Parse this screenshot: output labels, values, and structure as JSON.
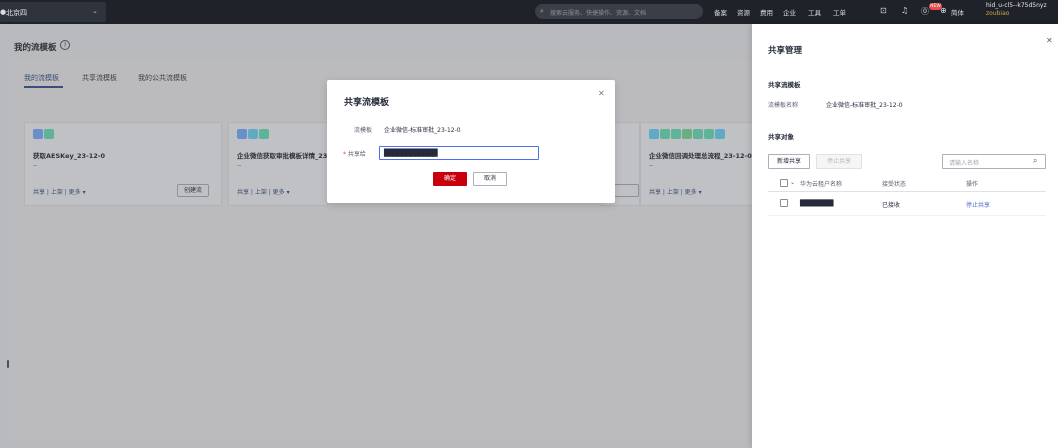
{
  "topbar": {
    "region": "北京四",
    "search_placeholder": "搜索云服务、快捷操作、资源、文档",
    "links": [
      "备案",
      "资源",
      "费用",
      "企业",
      "工具",
      "工单"
    ],
    "language": "简体",
    "badge": "NEW",
    "user_name": "hid_u-cl5--k75d5nyz",
    "user_sub": "zoubiao"
  },
  "page": {
    "title": "我的流模板",
    "tabs": [
      "我的流模板",
      "共享流模板",
      "我的公共流模板"
    ],
    "cards": [
      {
        "title": "获取AESKey_23-12-0",
        "desc": "--",
        "links": "共享 | 上架 | 更多 ▾",
        "button": "创建流",
        "icon_colors": [
          "#4e7fcf",
          "#3fae8a"
        ]
      },
      {
        "title": "企业微信获取审批模板详情_23-1",
        "desc": "--",
        "links": "共享 | 上架 | 更多 ▾",
        "button": "",
        "icon_colors": [
          "#4e7fcf",
          "#3fa2c4",
          "#3fae8a"
        ]
      },
      {
        "title": "企业微信回调处理总流程_23-12-0",
        "desc": "--",
        "links": "共享 | 上架 | 更多 ▾",
        "button": "",
        "icon_colors": [
          "#3fa2c4",
          "#3fae8a",
          "#3fae8a",
          "#4fa86a",
          "#3fae8a",
          "#3fae8a",
          "#3fa2c4"
        ]
      }
    ]
  },
  "dialog": {
    "title": "共享流模板",
    "template_label": "流模板",
    "template_value": "企业微信-标准审批_23-12-0",
    "share_to_label": "共享给",
    "share_to_value": "████████████",
    "ok_label": "确定",
    "cancel_label": "取消"
  },
  "drawer": {
    "title": "共享管理",
    "section_template": "共享流模板",
    "template_name_label": "流模板名称",
    "template_name_value": "企业微信-标准审批_23-12-0",
    "section_target": "共享对象",
    "new_share_label": "新增共享",
    "stop_share_label": "停止共享",
    "search_placeholder": "请输入名称",
    "columns": [
      "华为云租户名称",
      "接受状态",
      "操作"
    ],
    "rows": [
      {
        "tenant": "█████████",
        "status": "已接收",
        "action": "停止共享"
      }
    ]
  }
}
